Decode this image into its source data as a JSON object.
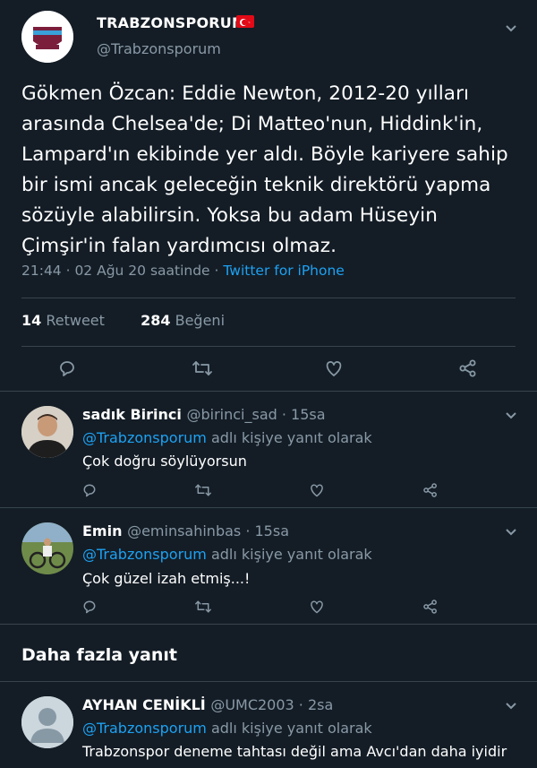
{
  "main_tweet": {
    "display_name": "TRABZONSPORUM",
    "handle": "@Trabzonsporum",
    "text": "Gökmen Özcan: Eddie Newton, 2012-20 yılları arasında Chelsea'de; Di Matteo'nun, Hiddink'in, Lampard'ın ekibinde yer aldı. Böyle kariyere sahip bir ismi ancak geleceğin teknik direktörü yapma sözüyle alabilirsin. Yoksa bu adam Hüseyin Çimşir'in falan yardımcısı olmaz.",
    "time_date": "21:44 · 02 Ağu 20 saatinde · ",
    "source": "Twitter for iPhone",
    "retweet_count": "14",
    "retweet_label": "Retweet",
    "like_count": "284",
    "like_label": "Beğeni"
  },
  "replies": [
    {
      "name": "sadık Birinci",
      "handle": "@birinci_sad · 15sa",
      "reply_to": "@Trabzonsporum",
      "reply_suffix": " adlı kişiye yanıt olarak",
      "text": "Çok doğru söylüyorsun"
    },
    {
      "name": "Emin",
      "handle": "@eminsahinbas · 15sa",
      "reply_to": "@Trabzonsporum",
      "reply_suffix": " adlı kişiye yanıt olarak",
      "text": "Çok güzel izah etmiş...!"
    }
  ],
  "more_replies_title": "Daha fazla yanıt",
  "more_replies": [
    {
      "name": "AYHAN CENİKLİ",
      "handle": "@UMC2003 · 2sa",
      "reply_to": "@Trabzonsporum",
      "reply_suffix": " adlı kişiye yanıt olarak",
      "text": "Trabzonspor deneme tahtası değil ama Avcı'dan daha iyidir"
    }
  ],
  "icons": {
    "reply": "reply-icon",
    "retweet": "retweet-icon",
    "like": "heart-icon",
    "share": "share-icon",
    "menu": "chevron-down-icon",
    "flag": "turkey-flag-icon"
  },
  "colors": {
    "background": "#141d26",
    "link": "#1da1f2",
    "muted": "#8899a6",
    "divider": "#38444d",
    "flag": "#e30a17"
  }
}
